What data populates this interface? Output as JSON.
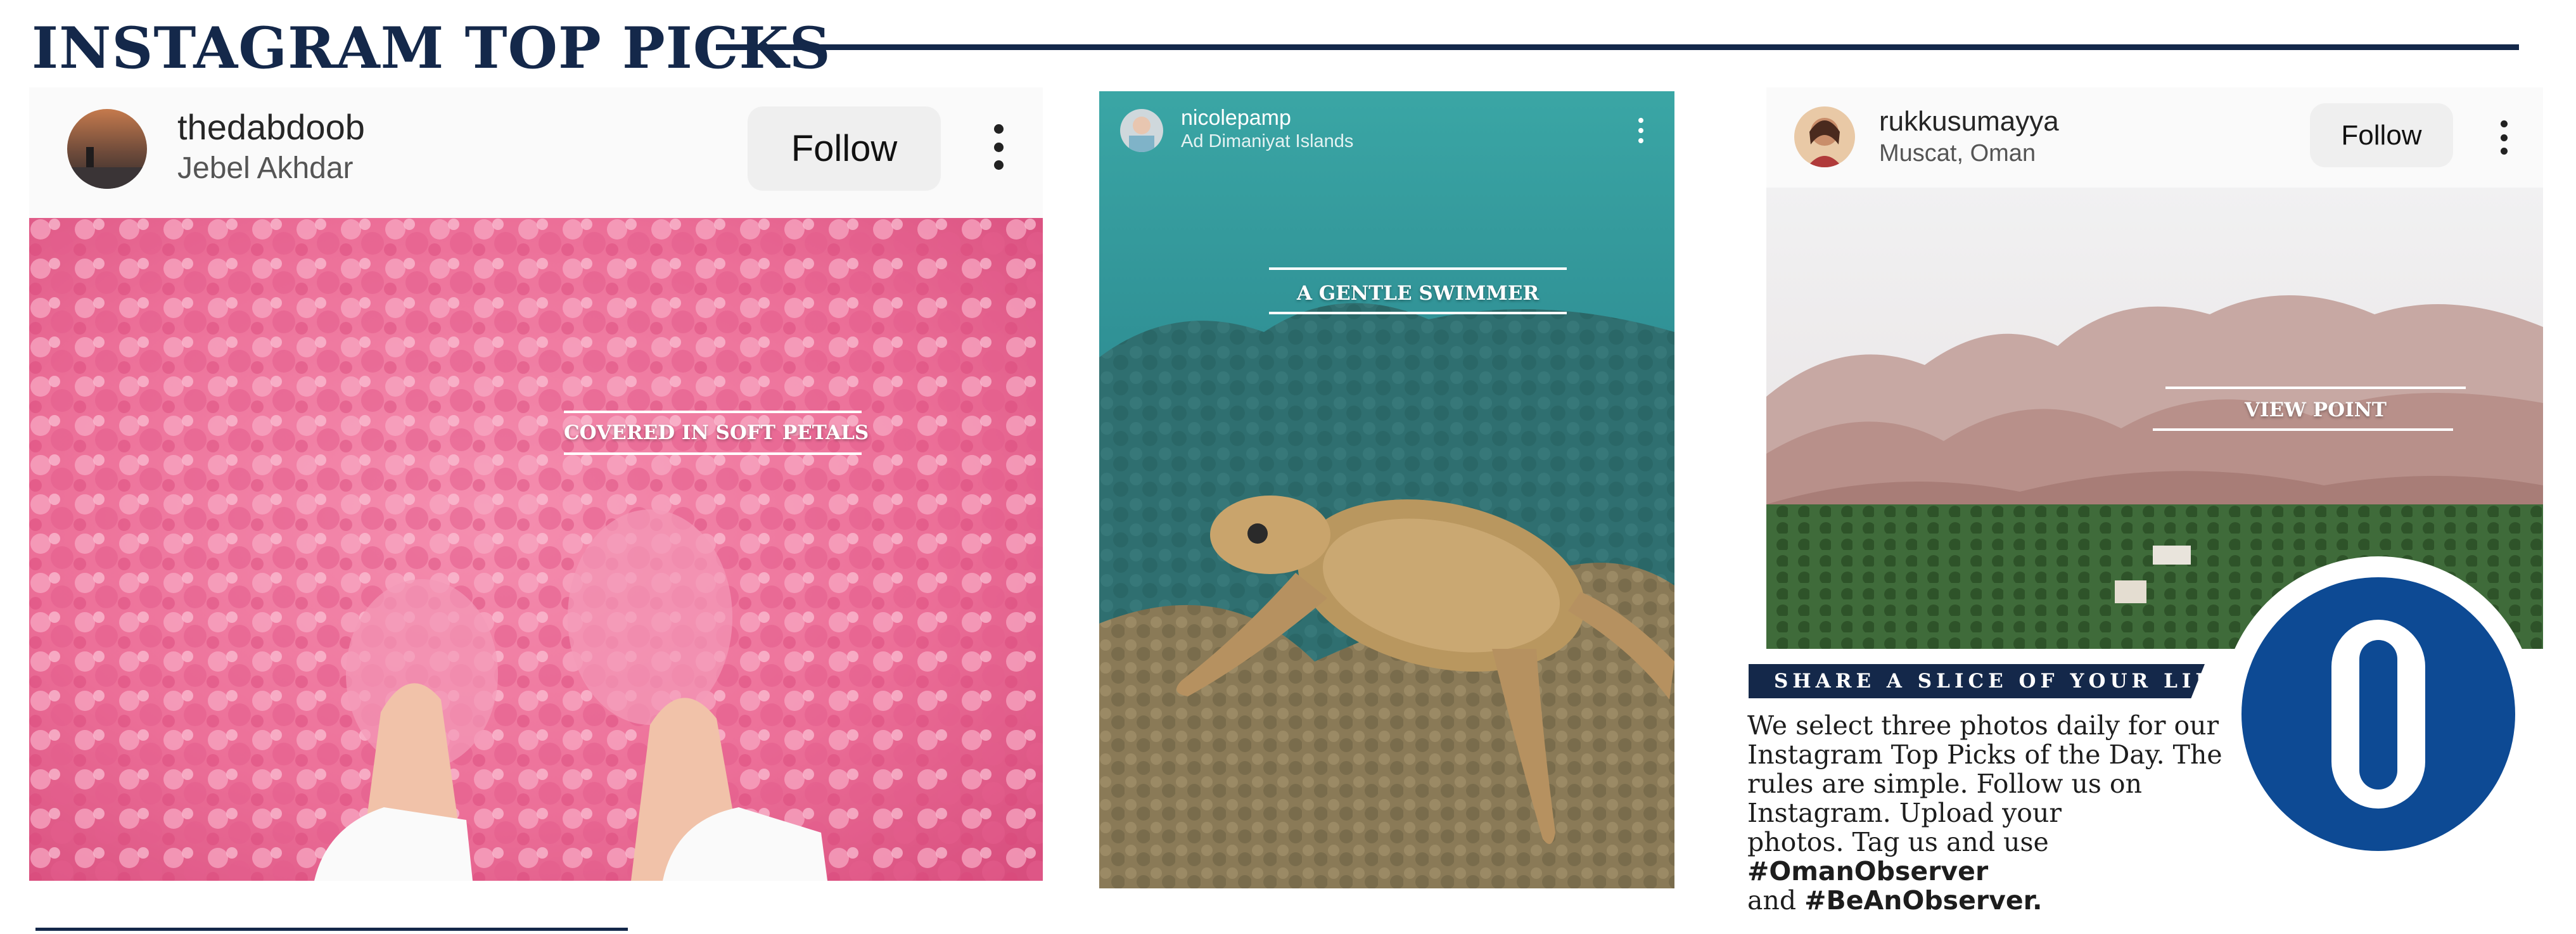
{
  "section_title": "INSTAGRAM TOP PICKS",
  "colors": {
    "navy": "#14284a",
    "logo_blue": "#0d4a94"
  },
  "posts": [
    {
      "username": "thedabdoob",
      "location": "Jebel Akhdar",
      "follow_label": "Follow",
      "caption": "COVERED IN SOFT PETALS",
      "image": "pink-rose-petals-in-hands"
    },
    {
      "username": "nicolepamp",
      "location": "Ad Dimaniyat Islands",
      "caption": "A GENTLE SWIMMER",
      "image": "sea-turtle-over-coral"
    },
    {
      "username": "rukkusumayya",
      "location": "Muscat, Oman",
      "follow_label": "Follow",
      "caption": "VIEW POINT",
      "image": "mountains-and-palm-oasis"
    }
  ],
  "feature": {
    "banner": "SHARE A SLICE OF YOUR LIFE",
    "body_lines": [
      "We select three photos daily for our",
      "Instagram Top Picks of the Day. The",
      "rules are simple. Follow us on",
      "Instagram. Upload your"
    ],
    "body_line5_prefix": "photos. Tag us and use ",
    "hashtag1": "#OmanObserver",
    "body_line6_prefix": "and ",
    "hashtag2": "#BeAnObserver."
  },
  "icons": {
    "menu": "vertical-dots-icon",
    "logo": "oman-observer-logo"
  }
}
